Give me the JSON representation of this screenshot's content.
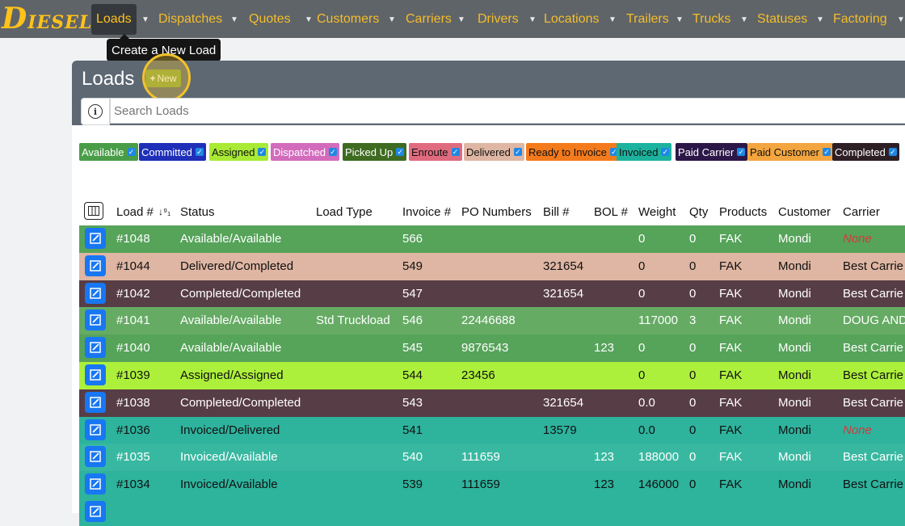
{
  "nav": {
    "logo_initial": "D",
    "logo_rest": "IESEL",
    "items": [
      {
        "label": "Loads"
      },
      {
        "label": "Dispatches"
      },
      {
        "label": "Quotes"
      },
      {
        "label": "Customers"
      },
      {
        "label": "Carriers"
      },
      {
        "label": "Drivers"
      },
      {
        "label": "Locations"
      },
      {
        "label": "Trailers"
      },
      {
        "label": "Trucks"
      },
      {
        "label": "Statuses"
      },
      {
        "label": "Factoring"
      }
    ]
  },
  "tooltip": "Create a New Load",
  "page": {
    "title": "Loads",
    "new_button": "New",
    "search_placeholder": "Search Loads"
  },
  "filters": [
    {
      "label": "Available",
      "bg": "#4a9d48",
      "fg": "#ffffff"
    },
    {
      "label": "Committed",
      "bg": "#1f2fb8",
      "fg": "#ffffff"
    },
    {
      "label": "Assigned",
      "bg": "#a8ea34",
      "fg": "#111111"
    },
    {
      "label": "Dispatched",
      "bg": "#d36bbd",
      "fg": "#ffffff"
    },
    {
      "label": "Picked Up",
      "bg": "#3e6b20",
      "fg": "#ffffff"
    },
    {
      "label": "Enroute",
      "bg": "#e06b7f",
      "fg": "#111111"
    },
    {
      "label": "Delivered",
      "bg": "#dfb6a3",
      "fg": "#111111"
    },
    {
      "label": "Ready to Invoice",
      "bg": "#f47b1c",
      "fg": "#111111"
    },
    {
      "label": "Invoiced",
      "bg": "#1cb39e",
      "fg": "#111111"
    },
    {
      "label": "Paid Carrier",
      "bg": "#2d1748",
      "fg": "#ffffff"
    },
    {
      "label": "Paid Customer",
      "bg": "#f3a63f",
      "fg": "#111111"
    },
    {
      "label": "Completed",
      "bg": "#2e1f25",
      "fg": "#ffffff"
    }
  ],
  "table": {
    "headers": [
      "Load #",
      "Status",
      "Load Type",
      "Invoice #",
      "PO Numbers",
      "Bill #",
      "BOL #",
      "Weight",
      "Qty",
      "Products",
      "Customer",
      "Carrier"
    ],
    "sort_icon": "↓⁹₁",
    "rows": [
      {
        "load": "#1048",
        "status": "Available/Available",
        "load_type": "",
        "invoice": "566",
        "po": "",
        "bill": "",
        "bol": "",
        "weight": "0",
        "qty": "0",
        "products": "FAK",
        "customer": "Mondi",
        "carrier": "None",
        "carrier_none": true,
        "bg": "#56a35a",
        "fg": "#ffffff"
      },
      {
        "load": "#1044",
        "status": "Delivered/Completed",
        "load_type": "",
        "invoice": "549",
        "po": "",
        "bill": "321654",
        "bol": "",
        "weight": "0",
        "qty": "0",
        "products": "FAK",
        "customer": "Mondi",
        "carrier": "Best Carrie",
        "carrier_none": false,
        "bg": "#dfb6a3",
        "fg": "#111111"
      },
      {
        "load": "#1042",
        "status": "Completed/Completed",
        "load_type": "",
        "invoice": "547",
        "po": "",
        "bill": "321654",
        "bol": "",
        "weight": "0",
        "qty": "0",
        "products": "FAK",
        "customer": "Mondi",
        "carrier": "Best Carrie",
        "carrier_none": false,
        "bg": "#573d45",
        "fg": "#ffffff"
      },
      {
        "load": "#1041",
        "status": "Available/Available",
        "load_type": "Std Truckload",
        "invoice": "546",
        "po": "22446688",
        "bill": "",
        "bol": "",
        "weight": "117000",
        "qty": "3",
        "products": "FAK",
        "customer": "Mondi",
        "carrier": "DOUG AND",
        "carrier_none": false,
        "bg": "#65ab64",
        "fg": "#ffffff"
      },
      {
        "load": "#1040",
        "status": "Available/Available",
        "load_type": "",
        "invoice": "545",
        "po": "9876543",
        "bill": "",
        "bol": "123",
        "weight": "0",
        "qty": "0",
        "products": "FAK",
        "customer": "Mondi",
        "carrier": "Best Carrie",
        "carrier_none": false,
        "bg": "#56a35a",
        "fg": "#ffffff"
      },
      {
        "load": "#1039",
        "status": "Assigned/Assigned",
        "load_type": "",
        "invoice": "544",
        "po": "23456",
        "bill": "",
        "bol": "",
        "weight": "0",
        "qty": "0",
        "products": "FAK",
        "customer": "Mondi",
        "carrier": "Best Carrie",
        "carrier_none": false,
        "bg": "#adf03b",
        "fg": "#111111"
      },
      {
        "load": "#1038",
        "status": "Completed/Completed",
        "load_type": "",
        "invoice": "543",
        "po": "",
        "bill": "321654",
        "bol": "",
        "weight": "0.0",
        "qty": "0",
        "products": "FAK",
        "customer": "Mondi",
        "carrier": "Best Carrie",
        "carrier_none": false,
        "bg": "#573d45",
        "fg": "#ffffff"
      },
      {
        "load": "#1036",
        "status": "Invoiced/Delivered",
        "load_type": "",
        "invoice": "541",
        "po": "",
        "bill": "13579",
        "bol": "",
        "weight": "0.0",
        "qty": "0",
        "products": "FAK",
        "customer": "Mondi",
        "carrier": "None",
        "carrier_none": true,
        "bg": "#2eb39d",
        "fg": "#111111"
      },
      {
        "load": "#1035",
        "status": "Invoiced/Available",
        "load_type": "",
        "invoice": "540",
        "po": "111659",
        "bill": "",
        "bol": "123",
        "weight": "188000",
        "qty": "0",
        "products": "FAK",
        "customer": "Mondi",
        "carrier": "Best Carrie",
        "carrier_none": false,
        "bg": "#38b8a1",
        "fg": "#ffffff"
      },
      {
        "load": "#1034",
        "status": "Invoiced/Available",
        "load_type": "",
        "invoice": "539",
        "po": "111659",
        "bill": "",
        "bol": "123",
        "weight": "146000",
        "qty": "0",
        "products": "FAK",
        "customer": "Mondi",
        "carrier": "Best Carrie",
        "carrier_none": false,
        "bg": "#2eb39d",
        "fg": "#111111"
      },
      {
        "load": "",
        "status": "",
        "load_type": "",
        "invoice": "",
        "po": "",
        "bill": "",
        "bol": "",
        "weight": "",
        "qty": "",
        "products": "",
        "customer": "",
        "carrier": "",
        "carrier_none": false,
        "bg": "#2eb39d",
        "fg": "#111111"
      }
    ]
  }
}
